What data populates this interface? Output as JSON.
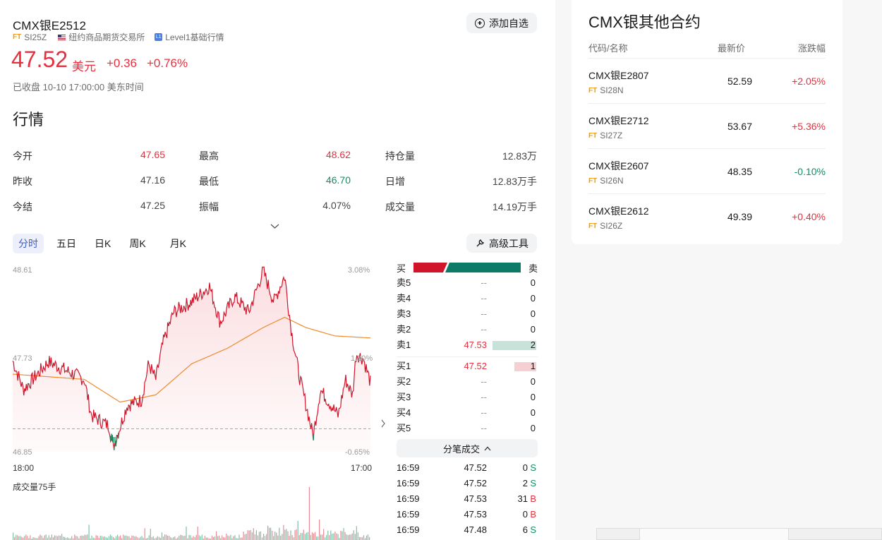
{
  "header": {
    "title": "CMX银E2512",
    "code": "SI25Z",
    "exchange": "纽约商品期货交易所",
    "level_badge": "L1",
    "level": "Level1基础行情",
    "add_watch": "添加自选"
  },
  "quote": {
    "price": "47.52",
    "currency": "美元",
    "change": "+0.36",
    "change_pct": "+0.76%",
    "status": "已收盘 10-10 17:00:00 美东时间"
  },
  "market": {
    "heading": "行情",
    "rows": [
      [
        {
          "label": "今开",
          "value": "47.65",
          "color": "red"
        },
        {
          "label": "最高",
          "value": "48.62",
          "color": "red"
        },
        {
          "label": "持仓量",
          "value": "12.83万",
          "color": "gray"
        }
      ],
      [
        {
          "label": "昨收",
          "value": "47.16",
          "color": "gray"
        },
        {
          "label": "最低",
          "value": "46.70",
          "color": "green"
        },
        {
          "label": "日增",
          "value": "12.83万手",
          "color": "gray"
        }
      ],
      [
        {
          "label": "今结",
          "value": "47.25",
          "color": "gray"
        },
        {
          "label": "振幅",
          "value": "4.07%",
          "color": "gray"
        },
        {
          "label": "成交量",
          "value": "14.19万手",
          "color": "gray"
        }
      ]
    ]
  },
  "tabs": [
    "分时",
    "五日",
    "日K",
    "周K",
    "月K"
  ],
  "tools_label": "高级工具",
  "chart": {
    "y_top": "48.61",
    "y_mid": "47.73",
    "y_bottom": "46.85",
    "pct_top": "3.08%",
    "pct_mid": "1.20%",
    "pct_bottom": "-0.65%",
    "x_start": "18:00",
    "x_end": "17:00",
    "volume_label": "成交量75手"
  },
  "orderbook": {
    "buy_label": "买",
    "sell_label": "卖",
    "asks": [
      {
        "label": "卖5",
        "price": "--",
        "vol": "0"
      },
      {
        "label": "卖4",
        "price": "--",
        "vol": "0"
      },
      {
        "label": "卖3",
        "price": "--",
        "vol": "0"
      },
      {
        "label": "卖2",
        "price": "--",
        "vol": "0"
      },
      {
        "label": "卖1",
        "price": "47.53",
        "vol": "2"
      }
    ],
    "bids": [
      {
        "label": "买1",
        "price": "47.52",
        "vol": "1"
      },
      {
        "label": "买2",
        "price": "--",
        "vol": "0"
      },
      {
        "label": "买3",
        "price": "--",
        "vol": "0"
      },
      {
        "label": "买4",
        "price": "--",
        "vol": "0"
      },
      {
        "label": "买5",
        "price": "--",
        "vol": "0"
      }
    ],
    "ticks_label": "分笔成交",
    "ticks": [
      {
        "time": "16:59",
        "price": "47.52",
        "vol": "0",
        "side": "S"
      },
      {
        "time": "16:59",
        "price": "47.52",
        "vol": "2",
        "side": "S"
      },
      {
        "time": "16:59",
        "price": "47.53",
        "vol": "31",
        "side": "B"
      },
      {
        "time": "16:59",
        "price": "47.53",
        "vol": "0",
        "side": "B"
      },
      {
        "time": "16:59",
        "price": "47.48",
        "vol": "6",
        "side": "S"
      }
    ]
  },
  "others": {
    "title": "CMX银其他合约",
    "col_name": "代码/名称",
    "col_price": "最新价",
    "col_chg": "涨跌幅",
    "rows": [
      {
        "name": "CMX银E2807",
        "code": "SI28N",
        "price": "52.59",
        "chg": "+2.05%"
      },
      {
        "name": "CMX银E2712",
        "code": "SI27Z",
        "price": "53.67",
        "chg": "+5.36%"
      },
      {
        "name": "CMX银E2607",
        "code": "SI26N",
        "price": "48.35",
        "chg": "-0.10%"
      },
      {
        "name": "CMX银E2612",
        "code": "SI26Z",
        "price": "49.39",
        "chg": "+0.40%"
      }
    ]
  },
  "colors": {
    "up": "#e5303e",
    "down": "#0e8f5f",
    "avg": "#f08a2b",
    "accent": "#3b5cc9"
  }
}
